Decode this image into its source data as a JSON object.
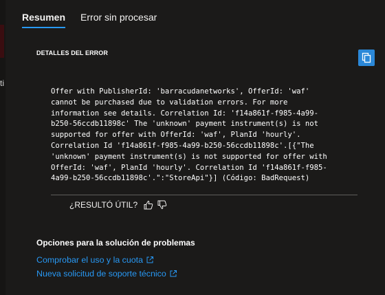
{
  "left_strip": {
    "fragment": "ti"
  },
  "tabs": [
    {
      "label": "Resumen",
      "active": true
    },
    {
      "label": "Error sin procesar",
      "active": false
    }
  ],
  "error_details": {
    "heading": "DETALLES DEL ERROR",
    "copy_icon": "copy-icon",
    "message": "Offer with PublisherId: 'barracudanetworks', OfferId: 'waf'\ncannot be purchased due to validation errors. For more\ninformation see details. Correlation Id: 'f14a861f-f985-4a99-\nb250-56ccdb11898c' The 'unknown' payment instrument(s) is not\nsupported for offer with OfferId: 'waf', PlanId 'hourly'.\nCorrelation Id 'f14a861f-f985-4a99-b250-56ccdb11898c'.[{\"The\n'unknown' payment instrument(s) is not supported for offer with\nOfferId: 'waf', PlanId 'hourly'. Correlation Id 'f14a861f-f985-\n4a99-b250-56ccdb11898c'.\":\"StoreApi\"}] (Código: BadRequest)"
  },
  "feedback": {
    "label": "¿RESULTÓ ÚTIL?",
    "thumbs_up_icon": "thumbs-up-icon",
    "thumbs_down_icon": "thumbs-down-icon"
  },
  "troubleshooting": {
    "title": "Opciones para la solución de problemas",
    "links": [
      {
        "label": "Comprobar el uso y la cuota"
      },
      {
        "label": "Nueva solicitud de soporte técnico"
      }
    ]
  },
  "colors": {
    "background": "#1b1a19",
    "accent": "#2899f5",
    "copy_button": "#2b88d8"
  }
}
